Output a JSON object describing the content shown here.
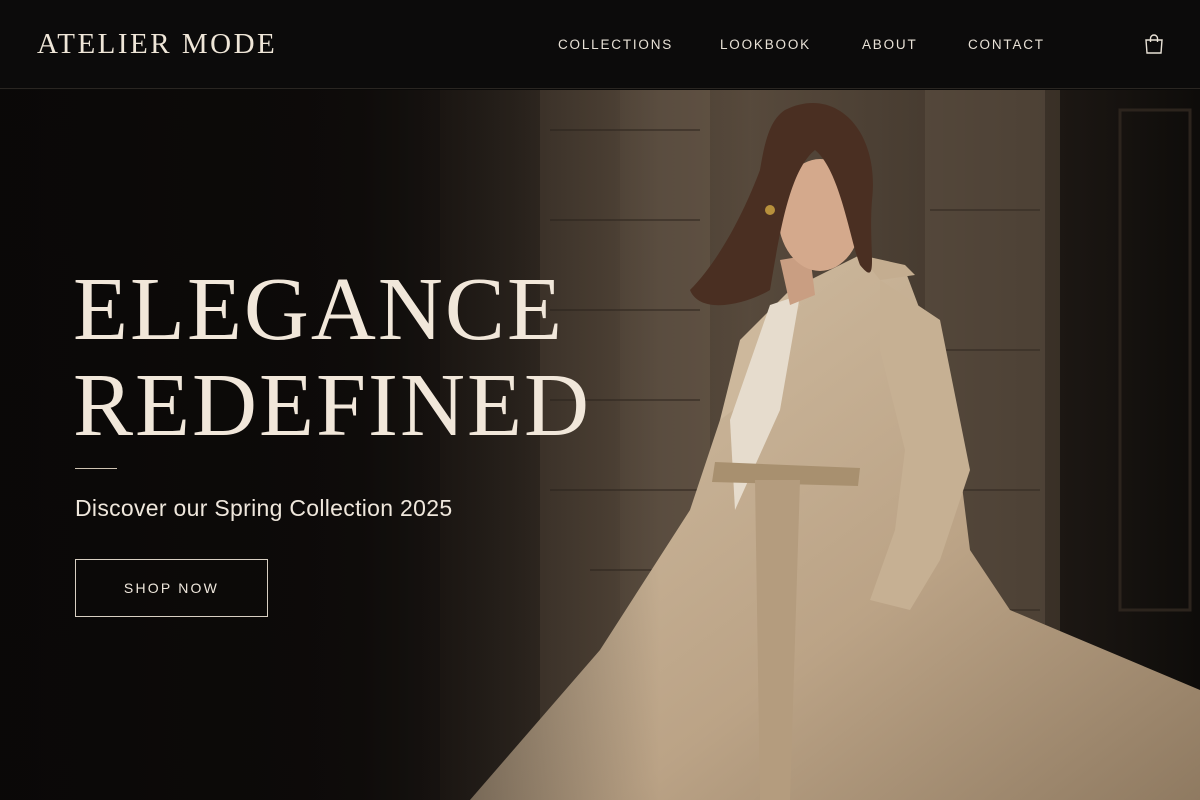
{
  "brand": {
    "logo": "ATELIER MODE"
  },
  "nav": {
    "items": [
      {
        "label": "COLLECTIONS"
      },
      {
        "label": "LOOKBOOK"
      },
      {
        "label": "ABOUT"
      },
      {
        "label": "CONTACT"
      }
    ],
    "cart_icon": "shopping-bag-icon"
  },
  "hero": {
    "headline_line1": "ELEGANCE",
    "headline_line2": "REDEFINED",
    "subtitle": "Discover our Spring Collection 2025",
    "cta_label": "SHOP NOW",
    "image": "model-in-trench-coat"
  },
  "colors": {
    "header_bg": "#0c0b0b",
    "text_light": "#f1e7da",
    "coat_beige": "#c9b49a",
    "stone": "#6b5d4e"
  }
}
